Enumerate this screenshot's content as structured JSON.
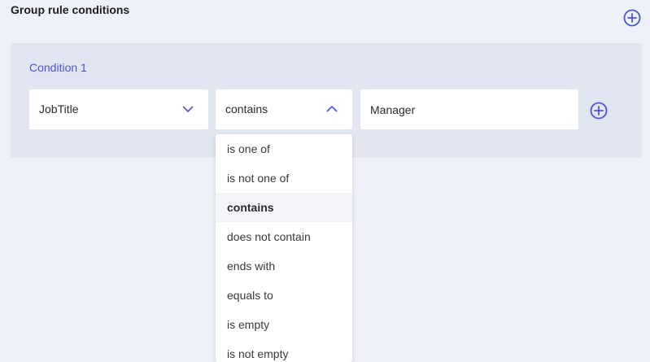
{
  "header": {
    "title": "Group rule conditions",
    "add_icon": "add-circle-icon"
  },
  "condition": {
    "label": "Condition 1",
    "attribute": {
      "value": "JobTitle",
      "icon": "chevron-down-icon"
    },
    "operator": {
      "value": "contains",
      "icon": "chevron-up-icon",
      "expanded": true
    },
    "input": {
      "value": "Manager"
    },
    "add_icon": "add-circle-icon"
  },
  "operator_options": [
    {
      "label": "is one of"
    },
    {
      "label": "is not one of"
    },
    {
      "label": "contains",
      "selected": true
    },
    {
      "label": "does not contain"
    },
    {
      "label": "ends with"
    },
    {
      "label": "equals to"
    },
    {
      "label": "is empty"
    },
    {
      "label": "is not empty"
    }
  ],
  "colors": {
    "accent": "#4b55d6",
    "page_background": "#eef1f8",
    "panel_background": "#e2e6f1"
  }
}
